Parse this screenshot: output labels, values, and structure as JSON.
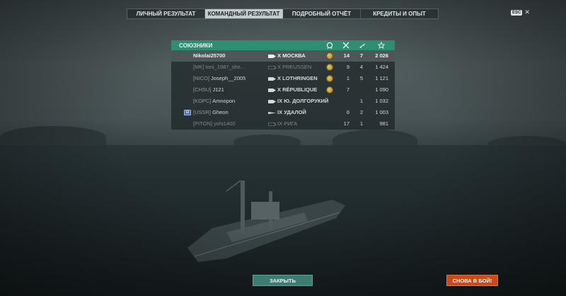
{
  "tabs": [
    {
      "label": "ЛИЧНЫЙ РЕЗУЛЬТАТ",
      "active": false
    },
    {
      "label": "КОМАНДНЫЙ РЕЗУЛЬТАТ",
      "active": true
    },
    {
      "label": "ПОДРОБНЫЙ ОТЧЁТ",
      "active": false
    },
    {
      "label": "КРЕДИТЫ И ОПЫТ",
      "active": false
    }
  ],
  "esc": {
    "key_label": "ESC",
    "close_glyph": "✕"
  },
  "team": {
    "title": "СОЮЗНИКИ",
    "header_icons": [
      "medal-icon",
      "destroyed-icon",
      "planes-icon",
      "experience-icon"
    ],
    "players": [
      {
        "clan": "",
        "name": "Nikolai25700",
        "tier": "X",
        "ship": "МОСКВА",
        "ship_type": "cruiser",
        "medal": true,
        "kills": "14",
        "planes": "7",
        "exp": "2 026",
        "self": true,
        "dead": false,
        "division": false
      },
      {
        "clan": "[MK]",
        "name": "toni_1987_she...",
        "tier": "X",
        "ship": "PREUSSEN",
        "ship_type": "battleship",
        "medal": true,
        "kills": "9",
        "planes": "4",
        "exp": "1 424",
        "self": false,
        "dead": true,
        "division": false
      },
      {
        "clan": "[NICO]",
        "name": "Joseph__2005",
        "tier": "X",
        "ship": "LOTHRINGEN",
        "ship_type": "cruiser",
        "medal": true,
        "kills": "1",
        "planes": "5",
        "exp": "1 121",
        "self": false,
        "dead": false,
        "division": false
      },
      {
        "clan": "[CHSU]",
        "name": "J121",
        "tier": "X",
        "ship": "RÉPUBLIQUE",
        "ship_type": "cruiser",
        "medal": true,
        "kills": "7",
        "planes": "",
        "exp": "1 090",
        "self": false,
        "dead": false,
        "division": false
      },
      {
        "clan": "[KOPC]",
        "name": "Amnopon",
        "tier": "IX",
        "ship": "Ю. ДОЛГОРУКИЙ",
        "ship_type": "cruiser",
        "medal": false,
        "kills": "",
        "planes": "1",
        "exp": "1 032",
        "self": false,
        "dead": false,
        "division": false
      },
      {
        "clan": "[USSR]",
        "name": "Gheon",
        "tier": "IX",
        "ship": "УДАЛОЙ",
        "ship_type": "destroyer",
        "medal": false,
        "kills": "6",
        "planes": "2",
        "exp": "1 003",
        "self": false,
        "dead": false,
        "division": true
      },
      {
        "clan": "[PITON]",
        "name": "yohi1400",
        "tier": "IX",
        "ship": "РИГА",
        "ship_type": "battleship",
        "medal": false,
        "kills": "17",
        "planes": "1",
        "exp": "981",
        "self": false,
        "dead": true,
        "division": false
      }
    ]
  },
  "buttons": {
    "close_label": "ЗАКРЫТЬ",
    "battle_label": "СНОВА В БОЙ!"
  },
  "colors": {
    "team_header": "#2e8e71",
    "close_button": "#3d7c72",
    "battle_button": "#cc4a14",
    "medal": "#c9a33e"
  }
}
